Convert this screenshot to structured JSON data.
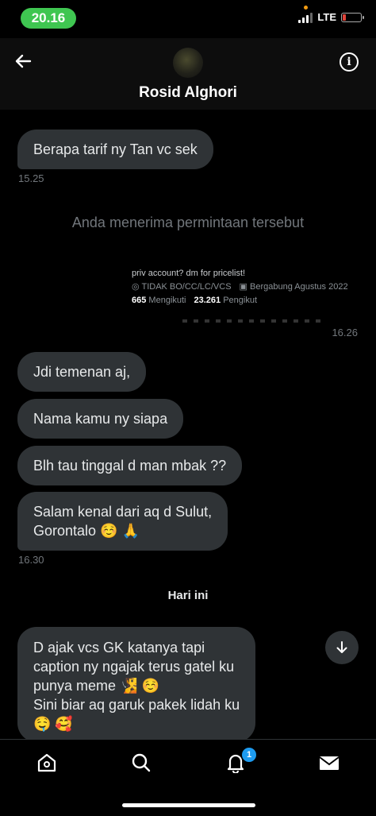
{
  "status_bar": {
    "time": "20.16",
    "network": "LTE"
  },
  "header": {
    "name": "Rosid Alghori"
  },
  "messages": {
    "m1": "Berapa tarif ny Tan vc sek",
    "ts1": "15.25",
    "system": "Anda menerima permintaan tersebut",
    "profile_card": {
      "bio": "priv account? dm for pricelist!",
      "location": "TIDAK BO/CC/LC/VCS",
      "joined": "Bergabung Agustus 2022",
      "following_count": "665",
      "following_label": "Mengikuti",
      "followers_count": "23.261",
      "followers_label": "Pengikut"
    },
    "ts2": "16.26",
    "m2": "Jdi temenan aj,",
    "m3": "Nama kamu ny siapa",
    "m4": "Blh tau tinggal d man mbak ??",
    "m5_line1": "Salam kenal dari aq d Sulut,",
    "m5_line2": "Gorontalo ☺️ 🙏",
    "ts3": "16.30",
    "day_divider": "Hari ini",
    "m6_line1": "D ajak vcs GK katanya tapi",
    "m6_line2": "caption ny ngajak terus gatel ku",
    "m6_line3": "punya meme 🧏 ☺️",
    "m6_line4": "Sini biar aq garuk pakek lidah ku",
    "m6_line5": "🤤 🥰"
  },
  "nav": {
    "notifications_badge": "1"
  },
  "icons": [
    "back-arrow-icon",
    "info-icon",
    "scroll-down-icon",
    "home-icon",
    "search-icon",
    "bell-icon",
    "mail-icon"
  ]
}
